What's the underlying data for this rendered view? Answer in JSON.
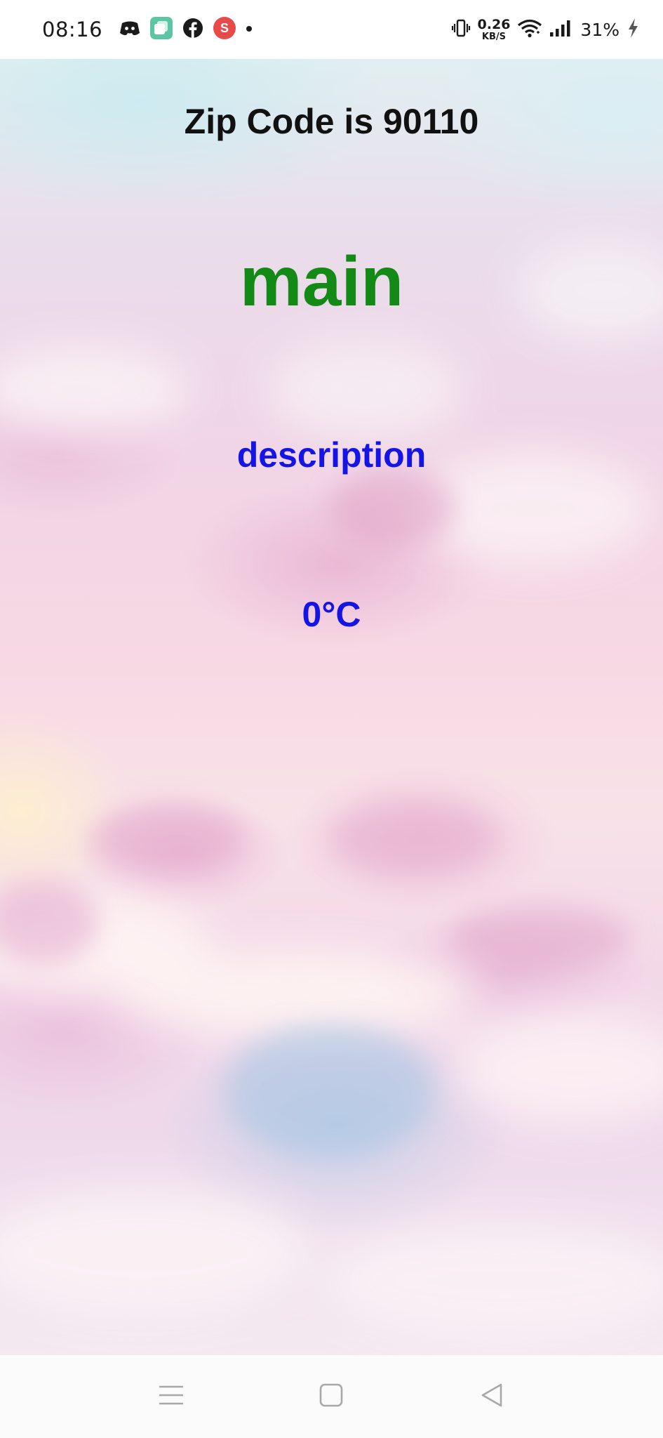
{
  "status_bar": {
    "time": "08:16",
    "net_speed_value": "0.26",
    "net_speed_unit": "KB/S",
    "battery_percent": "31%",
    "notification_icons": [
      "discord-icon",
      "app-icon",
      "facebook-icon",
      "s-app-icon",
      "more-notifications-dot-icon"
    ],
    "system_icons": [
      "vibrate-icon",
      "wifi-icon",
      "signal-icon",
      "charging-icon"
    ]
  },
  "weather": {
    "zip_title": "Zip Code is 90110",
    "main": "main",
    "description": "description",
    "temperature": "0°C"
  },
  "colors": {
    "main_text": "#138a16",
    "secondary_text": "#1414e6",
    "title_text": "#111111"
  },
  "nav_bar": {
    "buttons": [
      "menu-icon",
      "home-icon",
      "back-icon"
    ]
  }
}
